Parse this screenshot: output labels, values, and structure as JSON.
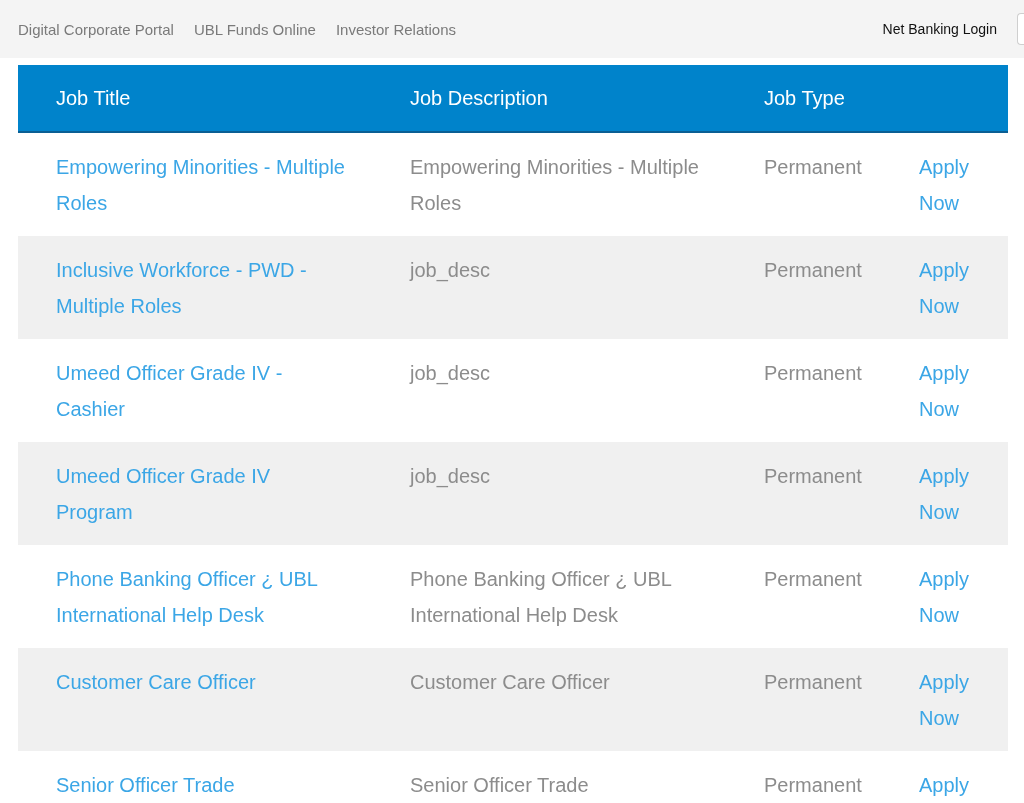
{
  "top_nav": {
    "links": [
      "Digital Corporate Portal",
      "UBL Funds Online",
      "Investor Relations"
    ],
    "login_link": "Net Banking Login"
  },
  "table": {
    "columns": [
      "Job Title",
      "Job Description",
      "Job Type"
    ],
    "rows": [
      {
        "title": "Empowering Minorities - Multiple Roles",
        "description": "Empowering Minorities - Multiple Roles",
        "type": "Permanent",
        "action": "Apply Now"
      },
      {
        "title": "Inclusive Workforce - PWD - Multiple Roles",
        "description": "job_desc",
        "type": "Permanent",
        "action": "Apply Now"
      },
      {
        "title": "Umeed Officer Grade IV - Cashier",
        "description": "job_desc",
        "type": "Permanent",
        "action": "Apply Now"
      },
      {
        "title": "Umeed Officer Grade IV Program",
        "description": "job_desc",
        "type": "Permanent",
        "action": "Apply Now"
      },
      {
        "title": "Phone Banking Officer ¿ UBL International Help Desk",
        "description": "Phone Banking Officer ¿ UBL International Help Desk",
        "type": "Permanent",
        "action": "Apply Now"
      },
      {
        "title": "Customer Care Officer",
        "description": "Customer Care Officer",
        "type": "Permanent",
        "action": "Apply Now"
      },
      {
        "title": "Senior Officer Trade",
        "description": "Senior Officer Trade",
        "type": "Permanent",
        "action": "Apply"
      }
    ]
  }
}
